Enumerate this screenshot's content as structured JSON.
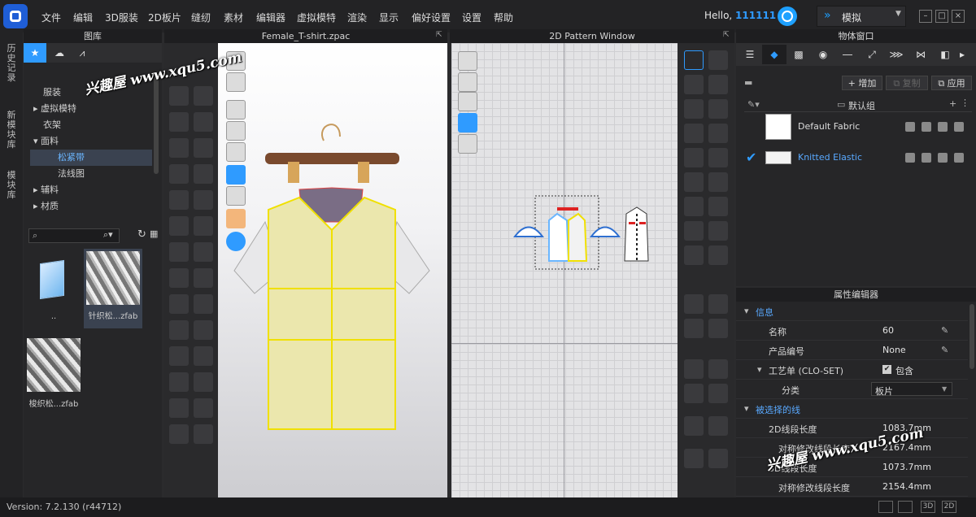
{
  "app": {
    "menu": [
      "文件",
      "编辑",
      "3D服装",
      "2D板片",
      "缝纫",
      "素材",
      "编辑器",
      "虚拟模特",
      "渲染",
      "显示",
      "偏好设置",
      "设置",
      "帮助"
    ],
    "hello_prefix": "Hello, ",
    "username": "111111",
    "mode": "模拟"
  },
  "vtabs": [
    "历史记录",
    "新模块库",
    "模块库"
  ],
  "library": {
    "title": "图库",
    "tree": [
      {
        "label": "服装",
        "arrow": ""
      },
      {
        "label": "虚拟模特",
        "arrow": "▸"
      },
      {
        "label": "衣架",
        "arrow": ""
      },
      {
        "label": "面料",
        "arrow": "▾"
      },
      {
        "label": "松紧带",
        "arrow": "",
        "selected": true
      },
      {
        "label": "法线图",
        "arrow": ""
      },
      {
        "label": "辅料",
        "arrow": "▸"
      },
      {
        "label": "材质",
        "arrow": "▸"
      }
    ],
    "files": [
      "..",
      "针织松...zfab",
      "梭织松...zfab"
    ]
  },
  "window3d": {
    "title": "Female_T-shirt.zpac"
  },
  "window2d": {
    "title": "2D Pattern Window"
  },
  "object_window": {
    "title": "物体窗口",
    "add": "增加",
    "copy": "复制",
    "apply": "应用",
    "group": "默认组",
    "fabrics": [
      {
        "name": "Default Fabric",
        "selected": false
      },
      {
        "name": "Knitted Elastic",
        "selected": true
      }
    ]
  },
  "property_editor": {
    "title": "属性编辑器",
    "info_section": "信息",
    "rows": [
      {
        "label": "名称",
        "value": "60"
      },
      {
        "label": "产品编号",
        "value": "None"
      },
      {
        "label": "工艺单 (CLO-SET)",
        "value": "包含"
      },
      {
        "label": "分类",
        "value": "板片"
      }
    ],
    "selected_section": "被选择的线",
    "line_rows": [
      {
        "label": "2D线段长度",
        "value": "1083.7mm"
      },
      {
        "label": "对称修改线段长度",
        "value": "2167.4mm"
      },
      {
        "label": "3D线段长度",
        "value": "1073.7mm"
      },
      {
        "label": "对称修改线段长度",
        "value": "2154.4mm"
      }
    ]
  },
  "status": {
    "version": "Version: 7.2.130 (r44712)",
    "view_3d": "3D",
    "view_2d": "2D"
  },
  "watermark": "兴趣屋 www.xqu5.com",
  "colors": {
    "accent": "#2e9bff",
    "selection": "#6ab6ff",
    "pattern_outline": "#f0e000"
  }
}
